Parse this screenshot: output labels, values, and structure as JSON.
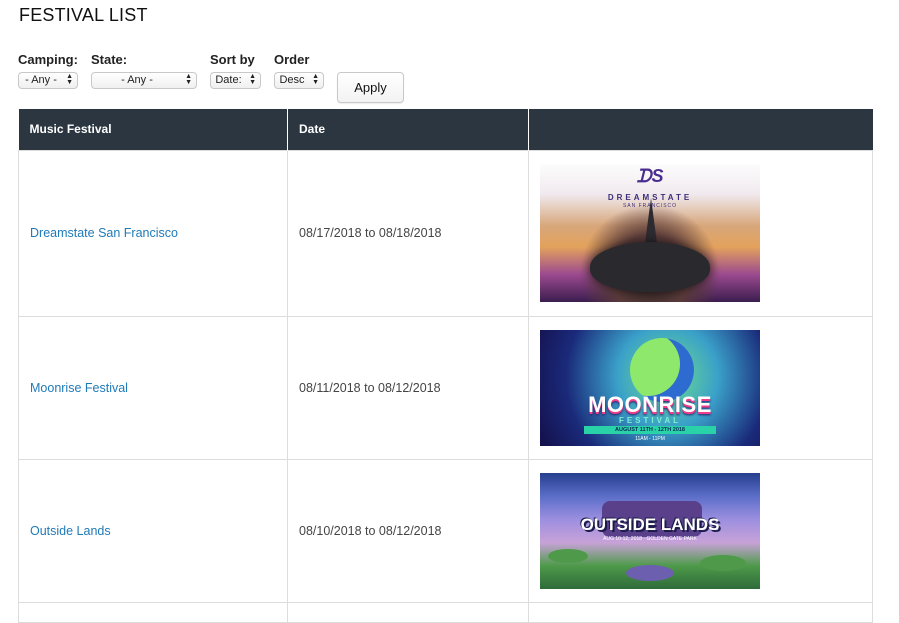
{
  "page_title": "FESTIVAL LIST",
  "filters": {
    "camping": {
      "label": "Camping:",
      "value": "- Any -"
    },
    "state": {
      "label": "State:",
      "value": "- Any -"
    },
    "sort_by": {
      "label": "Sort by",
      "value": "Date:"
    },
    "order": {
      "label": "Order",
      "value": "Desc"
    },
    "apply_label": "Apply"
  },
  "table": {
    "columns": [
      "Music Festival",
      "Date",
      ""
    ],
    "rows": [
      {
        "name": "Dreamstate San Francisco",
        "date": "08/17/2018 to 08/18/2018",
        "image": "dreamstate-poster",
        "poster_text": {
          "brand": "DREAMSTATE",
          "sub": "SAN FRANCISCO"
        }
      },
      {
        "name": "Moonrise Festival",
        "date": "08/11/2018 to 08/12/2018",
        "image": "moonrise-poster",
        "poster_text": {
          "word": "MOONRISE",
          "fest": "FESTIVAL",
          "dates": "AUGUST 11TH - 12TH 2018",
          "time": "11AM - 11PM"
        }
      },
      {
        "name": "Outside Lands",
        "date": "08/10/2018 to 08/12/2018",
        "image": "outside-lands-poster",
        "poster_text": {
          "word": "OUTSIDE LANDS",
          "sub": "AUG 10-12, 2018 · GOLDEN GATE PARK"
        }
      }
    ]
  },
  "colors": {
    "header_bg": "#2b3641",
    "link": "#1f7ab8"
  }
}
